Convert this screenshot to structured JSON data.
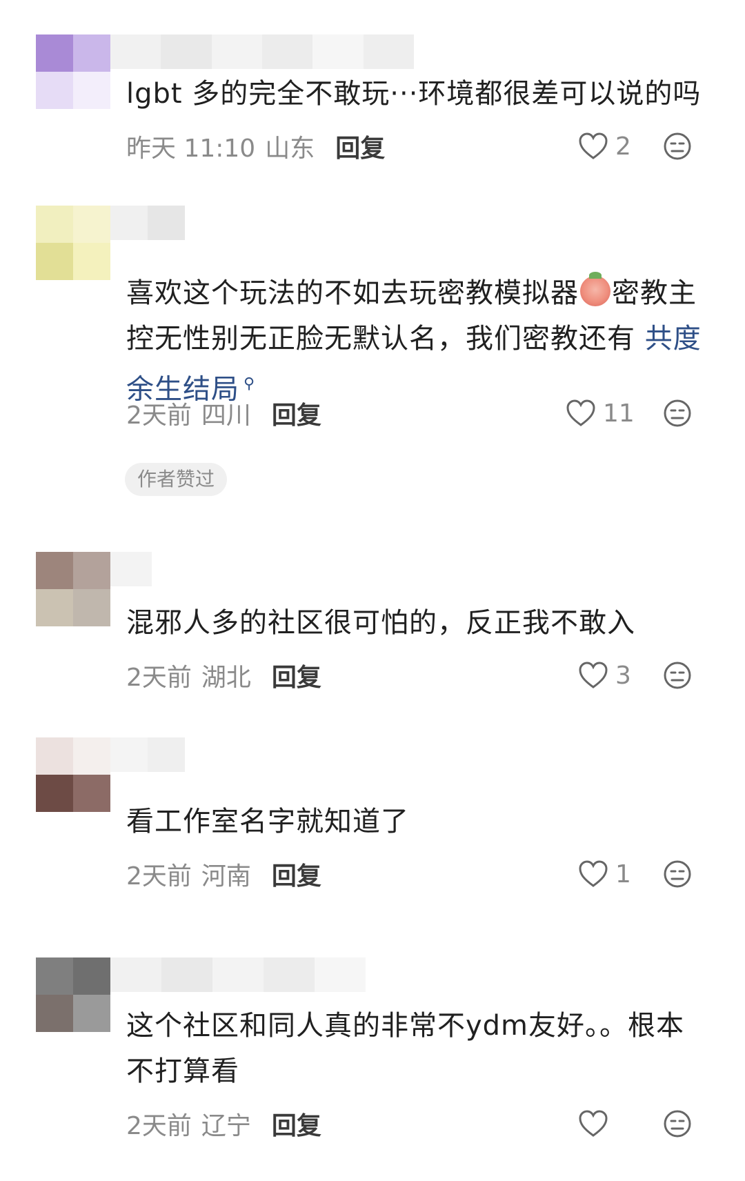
{
  "comments": [
    {
      "text": "lgbt 多的完全不敢玩···环境都很差可以说的吗",
      "time": "昨天 11:10",
      "location": "山东",
      "reply_label": "回复",
      "likes": "2",
      "avatar_colors": [
        "#a98ad6",
        "#cab7ea",
        "#e6dcf6",
        "#f3eefb"
      ]
    },
    {
      "text_before": "喜欢这个玩法的不如去玩密教模拟器",
      "text_after": "密教主控无性别无正脸无默认名，我们密教还有 ",
      "topic_link": "共度余生结局",
      "time": "2天前",
      "location": "四川",
      "reply_label": "回复",
      "likes": "11",
      "badge": "作者赞过",
      "avatar_colors": [
        "#f1efbf",
        "#f6f3cf",
        "#e2df96",
        "#f4f1bd"
      ]
    },
    {
      "text": "混邪人多的社区很可怕的，反正我不敢入",
      "time": "2天前",
      "location": "湖北",
      "reply_label": "回复",
      "likes": "3",
      "avatar_colors": [
        "#9d857c",
        "#b3a29b",
        "#cbc2b2",
        "#c0b7ad"
      ]
    },
    {
      "text": "看工作室名字就知道了",
      "time": "2天前",
      "location": "河南",
      "reply_label": "回复",
      "likes": "1",
      "avatar_colors": [
        "#ece1df",
        "#f4efed",
        "#6d4b45",
        "#8c6b66"
      ]
    },
    {
      "text": "这个社区和同人真的非常不ydm友好。。根本不打算看",
      "time": "2天前",
      "location": "辽宁",
      "reply_label": "回复",
      "likes": "",
      "avatar_colors": [
        "#7f7f7f",
        "#6f6f6f",
        "#7b706c",
        "#9a9a9a"
      ]
    }
  ]
}
